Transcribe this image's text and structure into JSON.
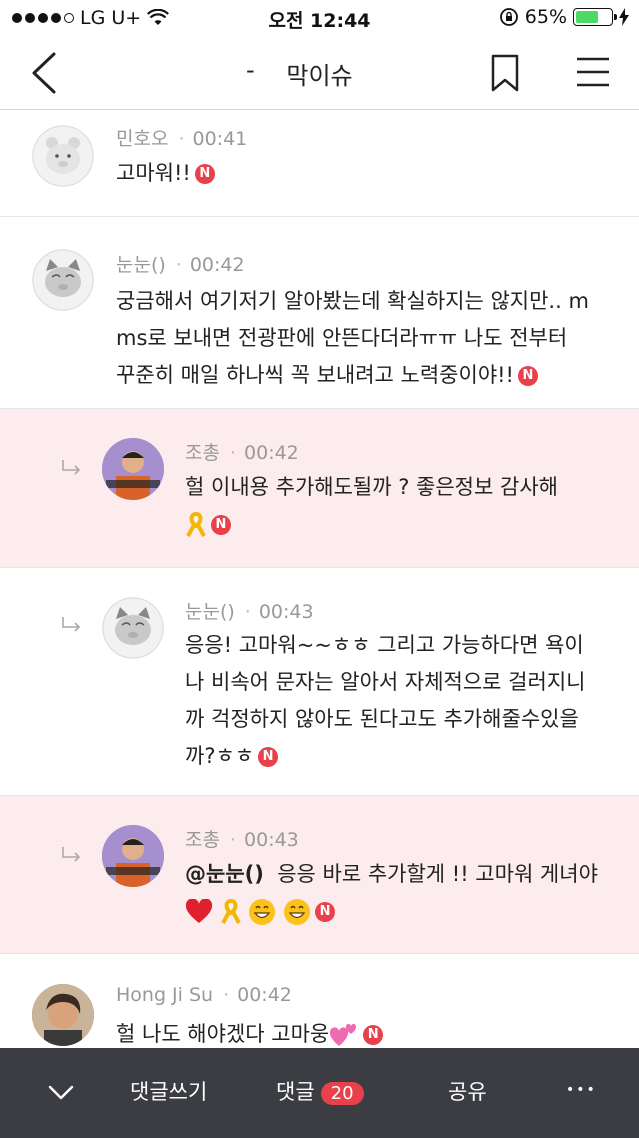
{
  "status_bar": {
    "carrier": "LG U+",
    "time": "오전 12:44",
    "battery_percent": "65%",
    "battery_level": 0.65
  },
  "nav": {
    "dash": "-",
    "title": "막이슈"
  },
  "comments": [
    {
      "author": "민호오",
      "time": "00:41",
      "text": "고마워!!",
      "badge": "N"
    },
    {
      "author": "눈눈()",
      "time": "00:42",
      "lines": [
        "궁금해서 여기저기 알아봤는데 확실하지는 않지만.. m",
        "ms로 보내면 전광판에 안뜬다더라ㅠㅠ 나도 전부터",
        "꾸준히 매일 하나씩 꼭 보내려고 노력중이야!!"
      ],
      "badge": "N"
    },
    {
      "author": "조총",
      "time": "00:42",
      "lines": [
        "헐 이내용 추가해도될까 ? 좋은정보 감사해"
      ],
      "badge": "N"
    },
    {
      "author": "눈눈()",
      "time": "00:43",
      "lines": [
        "응응! 고마워~~ㅎㅎ 그리고 가능하다면 욕이",
        "나 비속어 문자는 알아서 자체적으로 걸러지니",
        "까 걱정하지 않아도 된다고도 추가해줄수있을",
        "까?ㅎㅎ"
      ],
      "badge": "N"
    },
    {
      "author": "조총",
      "time": "00:43",
      "mention": "@눈눈()",
      "text": "응응 바로 추가할게 !! 고마워 게녀야",
      "badge": "N"
    },
    {
      "author": "Hong Ji Su",
      "time": "00:42",
      "text": "헐 나도 해야겠다 고마웅",
      "badge": "N"
    }
  ],
  "bottom_bar": {
    "write_label": "댓글쓰기",
    "comments_label": "댓글",
    "comments_count": "20",
    "share_label": "공유",
    "more_label": "•••"
  },
  "colors": {
    "highlight_bg": "#fcecee",
    "badge_red": "#e8414b",
    "bottom_bar_bg": "#3b3d42",
    "battery_green": "#4cd964"
  }
}
